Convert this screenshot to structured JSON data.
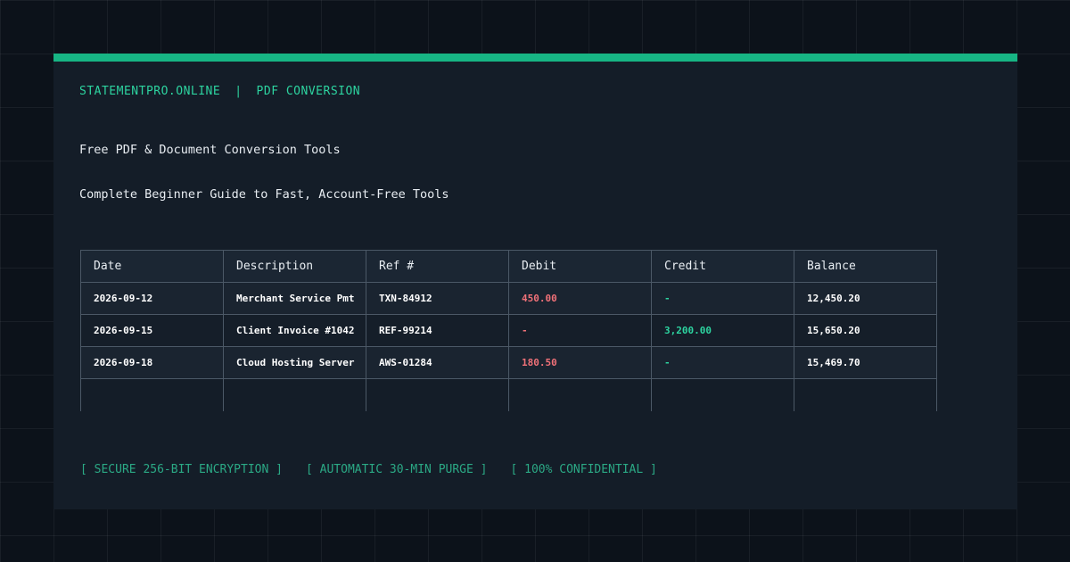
{
  "header": {
    "site": "STATEMENTPRO.ONLINE",
    "separator": "|",
    "section": "PDF CONVERSION"
  },
  "hero": {
    "title": "Free PDF & Document Conversion Tools",
    "subtitle": "Complete Beginner Guide to Fast, Account-Free Tools"
  },
  "table": {
    "columns": [
      "Date",
      "Description",
      "Ref #",
      "Debit",
      "Credit",
      "Balance"
    ],
    "rows": [
      {
        "date": "2026-09-12",
        "description": "Merchant Service Pmt",
        "ref": "TXN-84912",
        "debit": "450.00",
        "credit": "-",
        "balance": "12,450.20"
      },
      {
        "date": "2026-09-15",
        "description": "Client Invoice #1042",
        "ref": "REF-99214",
        "debit": "-",
        "credit": "3,200.00",
        "balance": "15,650.20"
      },
      {
        "date": "2026-09-18",
        "description": "Cloud Hosting Server",
        "ref": "AWS-01284",
        "debit": "180.50",
        "credit": "-",
        "balance": "15,469.70"
      }
    ]
  },
  "badges": [
    "[ SECURE 256-BIT ENCRYPTION ]",
    "[ AUTOMATIC 30-MIN PURGE ]",
    "[ 100% CONFIDENTIAL ]"
  ],
  "colors": {
    "accent": "#17b584",
    "debit": "#f07178",
    "credit": "#2dd4a0",
    "background": "#0c121a",
    "card": "#141d28"
  }
}
